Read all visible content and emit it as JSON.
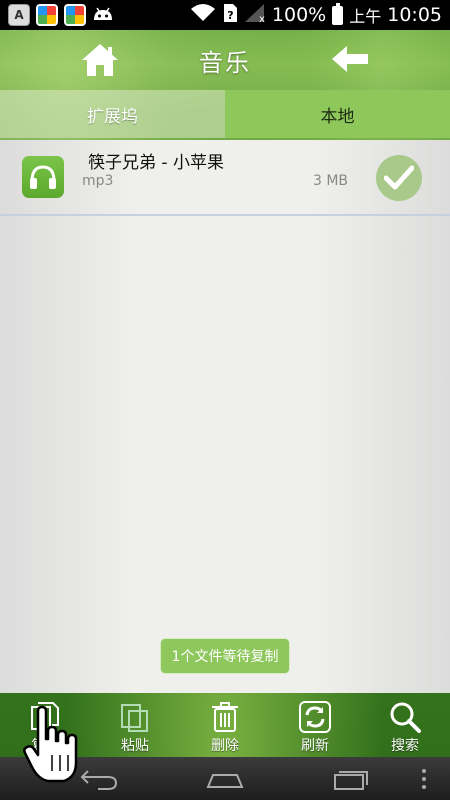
{
  "status_bar": {
    "battery": "100%",
    "time_period": "上午",
    "time": "10:05",
    "icons": [
      "keyboard-a-icon",
      "photo-app-icon",
      "photo-app-icon",
      "android-icon",
      "wifi-icon",
      "sim-icon",
      "signal-no-sim-icon",
      "battery-icon"
    ]
  },
  "header": {
    "title": "音乐"
  },
  "tabs": [
    {
      "label": "扩展坞",
      "active": false
    },
    {
      "label": "本地",
      "active": true
    }
  ],
  "files": [
    {
      "name": "筷子兄弟 - 小苹果",
      "type": "mp3",
      "size": "3 MB",
      "selected": true
    }
  ],
  "pending_badge": "1个文件等待复制",
  "toolbar": {
    "copy_label": "复制",
    "paste_label": "粘贴",
    "delete_label": "删除",
    "refresh_label": "刷新",
    "search_label": "搜索"
  },
  "colors": {
    "accent_green": "#8fc85a",
    "badge_green": "#8ec75c",
    "status_bar_bg": "#000000"
  }
}
